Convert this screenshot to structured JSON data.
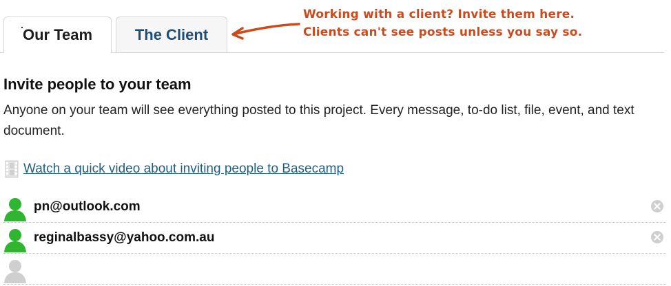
{
  "tabs": [
    {
      "label": "Our Team",
      "active": true
    },
    {
      "label": "The Client",
      "active": false
    }
  ],
  "annotation": {
    "line1": "Working with a client? Invite them here.",
    "line2": "Clients can't see posts unless you say so.",
    "color": "#cc4a1c"
  },
  "invite": {
    "heading": "Invite people to your team",
    "description": "Anyone on your team will see everything posted to this project. Every message, to-do list, file, event, and text document.",
    "video_link": "Watch a quick video about inviting people to Basecamp",
    "video_icon": "film-icon"
  },
  "invitees": [
    {
      "email": "pn@outlook.com",
      "avatar": "user-green-icon",
      "color": "#2fb52f"
    },
    {
      "email": "reginalbassy@yahoo.com.au",
      "avatar": "user-green-icon",
      "color": "#2fb52f"
    },
    {
      "email": "",
      "avatar": "user-gray-icon",
      "color": "#cfcfcf"
    }
  ],
  "colors": {
    "link": "#1f5f85",
    "tab_inactive_text": "#1f4e72"
  }
}
